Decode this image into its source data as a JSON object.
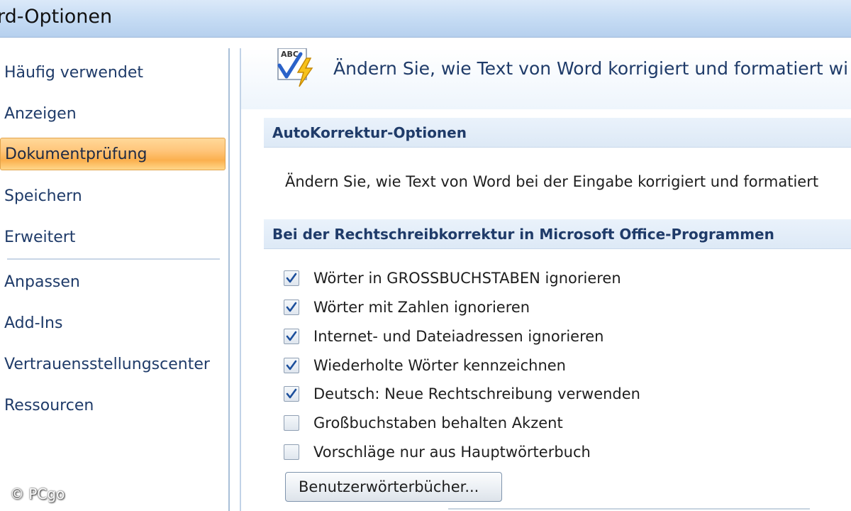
{
  "window": {
    "title": "rd-Optionen"
  },
  "sidebar": {
    "items": [
      {
        "label": "Häufig verwendet",
        "selected": false
      },
      {
        "label": "Anzeigen",
        "selected": false
      },
      {
        "label": "Dokumentprüfung",
        "selected": true
      },
      {
        "label": "Speichern",
        "selected": false
      },
      {
        "label": "Erweitert",
        "selected": false
      },
      {
        "label": "Anpassen",
        "selected": false
      },
      {
        "label": "Add-Ins",
        "selected": false
      },
      {
        "label": "Vertrauensstellungscenter",
        "selected": false
      },
      {
        "label": "Ressourcen",
        "selected": false
      }
    ]
  },
  "header": {
    "icon": "abc-check-icon",
    "text": "Ändern Sie, wie Text von Word korrigiert und formatiert wi"
  },
  "autocorrect": {
    "title": "AutoKorrektur-Optionen",
    "description": "Ändern Sie, wie Text von Word bei der Eingabe korrigiert und formatiert"
  },
  "spelling": {
    "title": "Bei der Rechtschreibkorrektur in Microsoft Office-Programmen",
    "options": [
      {
        "label": "Wörter in GROSSBUCHSTABEN ignorieren",
        "checked": true
      },
      {
        "label": "Wörter mit Zahlen ignorieren",
        "checked": true
      },
      {
        "label": "Internet- und Dateiadressen ignorieren",
        "checked": true
      },
      {
        "label": "Wiederholte Wörter kennzeichnen",
        "checked": true
      },
      {
        "label": "Deutsch: Neue Rechtschreibung verwenden",
        "checked": true
      },
      {
        "label": "Großbuchstaben behalten Akzent",
        "checked": false
      },
      {
        "label": "Vorschläge nur aus Hauptwörterbuch",
        "checked": false
      }
    ],
    "button_label": "Benutzerwörterbücher..."
  },
  "watermark": "© PCgo",
  "colors": {
    "selected_item": "#fbb04e",
    "check_mark": "#1c4f9c",
    "nav_text": "#1f3b69"
  }
}
